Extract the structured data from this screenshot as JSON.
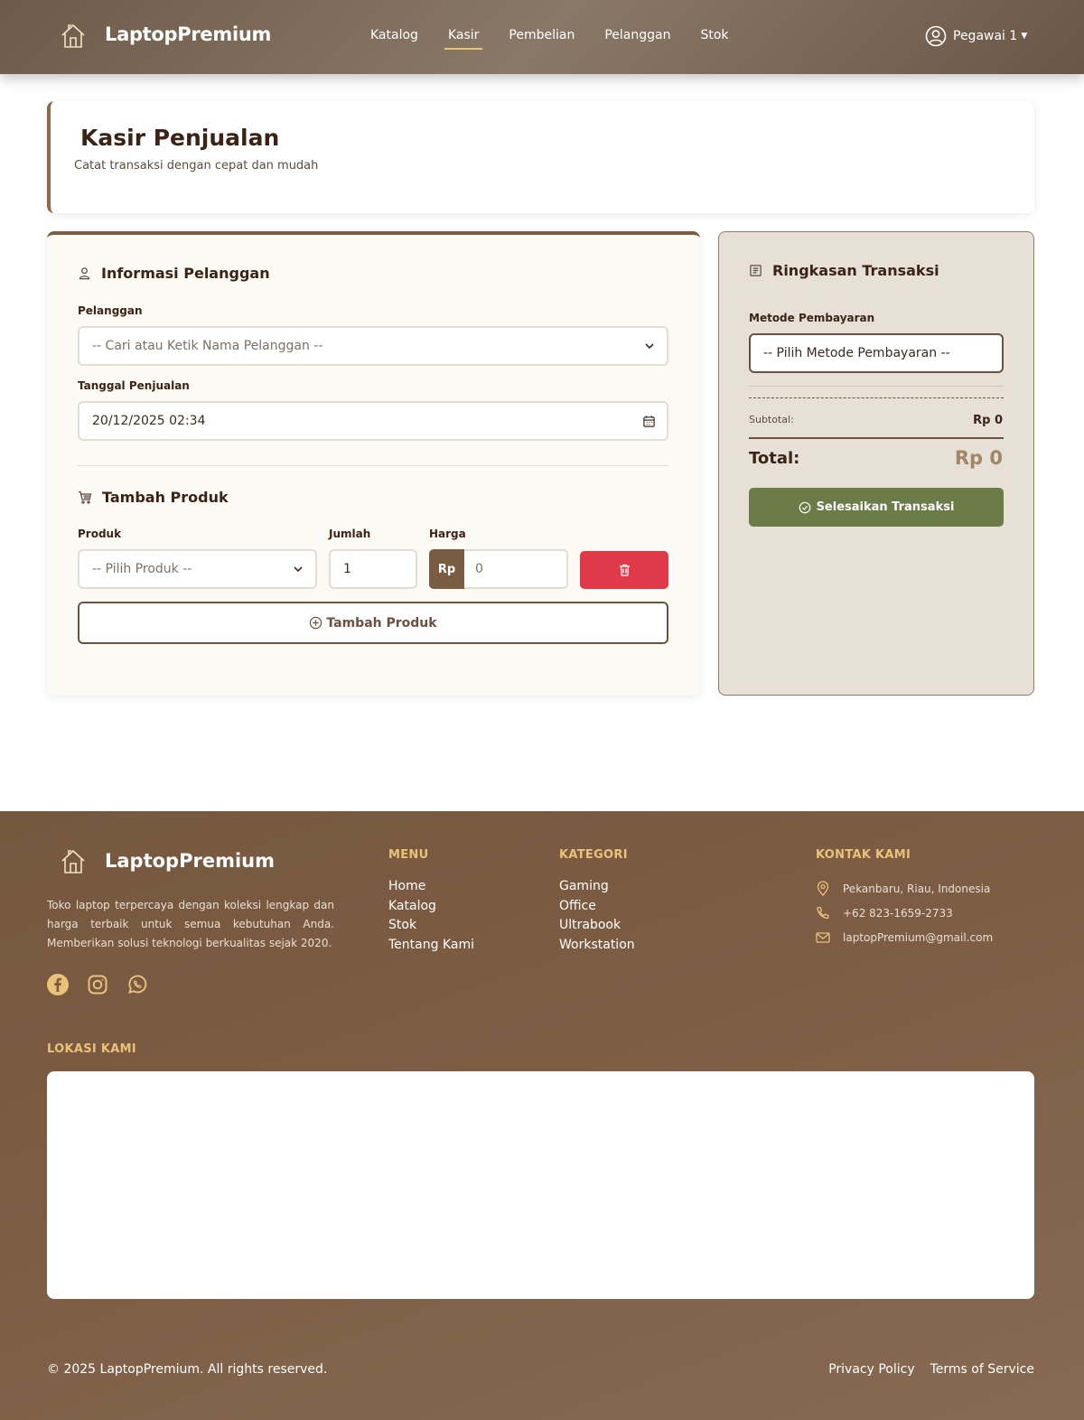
{
  "nav": {
    "brand": "LaptopPremium",
    "links": [
      "Katalog",
      "Kasir",
      "Pembelian",
      "Pelanggan",
      "Stok"
    ],
    "active": "Kasir",
    "user": "Pegawai 1"
  },
  "header": {
    "title": "Kasir Penjualan",
    "subtitle": "Catat transaksi dengan cepat dan mudah"
  },
  "customer": {
    "section_title": "Informasi Pelanggan",
    "customer_label": "Pelanggan",
    "customer_placeholder": "-- Cari atau Ketik Nama Pelanggan --",
    "date_label": "Tanggal Penjualan",
    "date_value": "20/12/2025 02:34"
  },
  "product": {
    "section_title": "Tambah Produk",
    "product_label": "Produk",
    "qty_label": "Jumlah",
    "price_label": "Harga",
    "product_placeholder": "-- Pilih Produk --",
    "qty_value": "1",
    "currency": "Rp",
    "price_value": "0",
    "add_button": "Tambah Produk"
  },
  "summary": {
    "title": "Ringkasan Transaksi",
    "payment_label": "Metode Pembayaran",
    "payment_placeholder": "-- Pilih Metode Pembayaran --",
    "subtotal_label": "Subtotal:",
    "subtotal_value": "Rp 0",
    "total_label": "Total:",
    "total_value": "Rp 0",
    "finish_button": "Selesaikan Transaksi"
  },
  "footer": {
    "brand": "LaptopPremium",
    "about": "Toko laptop terpercaya dengan koleksi lengkap dan harga terbaik untuk semua kebutuhan Anda. Memberikan solusi teknologi berkualitas sejak 2020.",
    "social_icons": [
      "facebook-icon",
      "instagram-icon",
      "whatsapp-icon"
    ],
    "menu_heading": "MENU",
    "menu": [
      "Home",
      "Katalog",
      "Stok",
      "Tentang Kami"
    ],
    "category_heading": "KATEGORI",
    "categories": [
      "Gaming",
      "Office",
      "Ultrabook",
      "Workstation"
    ],
    "contact_heading": "KONTAK KAMI",
    "contact": {
      "address": "Pekanbaru, Riau, Indonesia",
      "phone": "+62 823-1659-2733",
      "email": "laptopPremium@gmail.com"
    },
    "location_heading": "LOKASI KAMI",
    "copyright": "© 2025 LaptopPremium. All rights reserved.",
    "privacy": "Privacy Policy",
    "terms": "Terms of Service"
  },
  "colors": {
    "brand_brown": "#7a5c43",
    "accent_gold": "#e8c278",
    "danger": "#e0394a",
    "success": "#6b7c48"
  }
}
